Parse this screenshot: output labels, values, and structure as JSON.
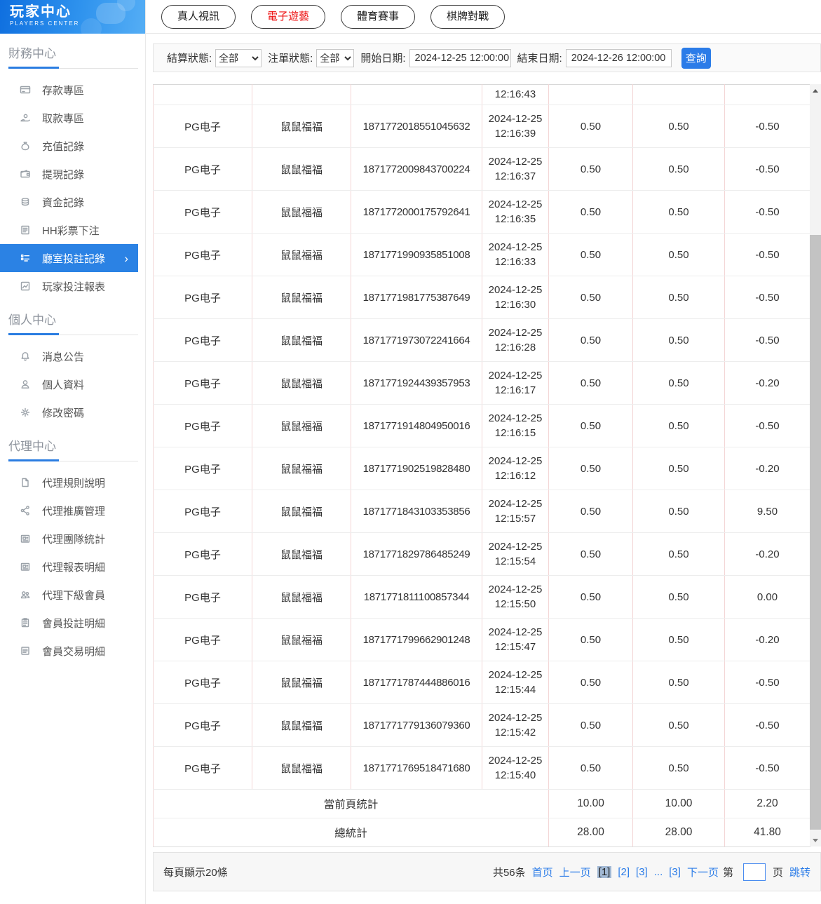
{
  "app": {
    "title": "玩家中心",
    "subtitle": "PLAYERS CENTER"
  },
  "sidebar": {
    "sections": [
      {
        "title": "財務中心",
        "items": [
          {
            "label": "存款專區",
            "icon": "deposit-card-icon",
            "active": false
          },
          {
            "label": "取款專區",
            "icon": "withdraw-hand-icon",
            "active": false
          },
          {
            "label": "充值記錄",
            "icon": "recharge-bag-icon",
            "active": false
          },
          {
            "label": "提現記錄",
            "icon": "cashout-wallet-icon",
            "active": false
          },
          {
            "label": "資金記錄",
            "icon": "funds-coins-icon",
            "active": false
          },
          {
            "label": "HH彩票下注",
            "icon": "lottery-doc-icon",
            "active": false
          },
          {
            "label": "廳室投註記錄",
            "icon": "bet-record-list-icon",
            "active": true
          },
          {
            "label": "玩家投注報表",
            "icon": "report-chart-icon",
            "active": false
          }
        ]
      },
      {
        "title": "個人中心",
        "items": [
          {
            "label": "消息公告",
            "icon": "bell-icon",
            "active": false
          },
          {
            "label": "個人資料",
            "icon": "person-icon",
            "active": false
          },
          {
            "label": "修改密碼",
            "icon": "gear-icon",
            "active": false
          }
        ]
      },
      {
        "title": "代理中心",
        "items": [
          {
            "label": "代理規則說明",
            "icon": "file-icon",
            "active": false
          },
          {
            "label": "代理推廣管理",
            "icon": "share-icon",
            "active": false
          },
          {
            "label": "代理團隊統計",
            "icon": "news-icon",
            "active": false
          },
          {
            "label": "代理報表明細",
            "icon": "news-icon",
            "active": false
          },
          {
            "label": "代理下級會員",
            "icon": "users-icon",
            "active": false
          },
          {
            "label": "會員投註明細",
            "icon": "clipboard-icon",
            "active": false
          },
          {
            "label": "會員交易明細",
            "icon": "list-icon",
            "active": false
          }
        ]
      }
    ]
  },
  "tabs": [
    {
      "label": "真人視訊",
      "active": false
    },
    {
      "label": "電子遊藝",
      "active": true
    },
    {
      "label": "體育賽事",
      "active": false
    },
    {
      "label": "棋牌對戰",
      "active": false
    }
  ],
  "filters": {
    "settle_status": {
      "label": "結算狀態:",
      "value": "全部"
    },
    "order_status": {
      "label": "注單狀態:",
      "value": "全部"
    },
    "start_date": {
      "label": "開始日期:",
      "value": "2024-12-25 12:00:00"
    },
    "end_date": {
      "label": "結束日期:",
      "value": "2024-12-26 12:00:00"
    },
    "search_label": "查詢"
  },
  "table": {
    "partial_row": {
      "time": "12:16:43"
    },
    "rows": [
      {
        "provider": "PG电子",
        "game": "鼠鼠福福",
        "order": "1871772018551045632",
        "date": "2024-12-25",
        "time": "12:16:39",
        "bet": "0.50",
        "valid": "0.50",
        "profit": "-0.50"
      },
      {
        "provider": "PG电子",
        "game": "鼠鼠福福",
        "order": "1871772009843700224",
        "date": "2024-12-25",
        "time": "12:16:37",
        "bet": "0.50",
        "valid": "0.50",
        "profit": "-0.50"
      },
      {
        "provider": "PG电子",
        "game": "鼠鼠福福",
        "order": "1871772000175792641",
        "date": "2024-12-25",
        "time": "12:16:35",
        "bet": "0.50",
        "valid": "0.50",
        "profit": "-0.50"
      },
      {
        "provider": "PG电子",
        "game": "鼠鼠福福",
        "order": "1871771990935851008",
        "date": "2024-12-25",
        "time": "12:16:33",
        "bet": "0.50",
        "valid": "0.50",
        "profit": "-0.50"
      },
      {
        "provider": "PG电子",
        "game": "鼠鼠福福",
        "order": "1871771981775387649",
        "date": "2024-12-25",
        "time": "12:16:30",
        "bet": "0.50",
        "valid": "0.50",
        "profit": "-0.50"
      },
      {
        "provider": "PG电子",
        "game": "鼠鼠福福",
        "order": "1871771973072241664",
        "date": "2024-12-25",
        "time": "12:16:28",
        "bet": "0.50",
        "valid": "0.50",
        "profit": "-0.50"
      },
      {
        "provider": "PG电子",
        "game": "鼠鼠福福",
        "order": "1871771924439357953",
        "date": "2024-12-25",
        "time": "12:16:17",
        "bet": "0.50",
        "valid": "0.50",
        "profit": "-0.20"
      },
      {
        "provider": "PG电子",
        "game": "鼠鼠福福",
        "order": "1871771914804950016",
        "date": "2024-12-25",
        "time": "12:16:15",
        "bet": "0.50",
        "valid": "0.50",
        "profit": "-0.50"
      },
      {
        "provider": "PG电子",
        "game": "鼠鼠福福",
        "order": "1871771902519828480",
        "date": "2024-12-25",
        "time": "12:16:12",
        "bet": "0.50",
        "valid": "0.50",
        "profit": "-0.20"
      },
      {
        "provider": "PG电子",
        "game": "鼠鼠福福",
        "order": "1871771843103353856",
        "date": "2024-12-25",
        "time": "12:15:57",
        "bet": "0.50",
        "valid": "0.50",
        "profit": "9.50"
      },
      {
        "provider": "PG电子",
        "game": "鼠鼠福福",
        "order": "1871771829786485249",
        "date": "2024-12-25",
        "time": "12:15:54",
        "bet": "0.50",
        "valid": "0.50",
        "profit": "-0.20"
      },
      {
        "provider": "PG电子",
        "game": "鼠鼠福福",
        "order": "1871771811100857344",
        "date": "2024-12-25",
        "time": "12:15:50",
        "bet": "0.50",
        "valid": "0.50",
        "profit": "0.00"
      },
      {
        "provider": "PG电子",
        "game": "鼠鼠福福",
        "order": "1871771799662901248",
        "date": "2024-12-25",
        "time": "12:15:47",
        "bet": "0.50",
        "valid": "0.50",
        "profit": "-0.20"
      },
      {
        "provider": "PG电子",
        "game": "鼠鼠福福",
        "order": "1871771787444886016",
        "date": "2024-12-25",
        "time": "12:15:44",
        "bet": "0.50",
        "valid": "0.50",
        "profit": "-0.50"
      },
      {
        "provider": "PG电子",
        "game": "鼠鼠福福",
        "order": "1871771779136079360",
        "date": "2024-12-25",
        "time": "12:15:42",
        "bet": "0.50",
        "valid": "0.50",
        "profit": "-0.50"
      },
      {
        "provider": "PG电子",
        "game": "鼠鼠福福",
        "order": "1871771769518471680",
        "date": "2024-12-25",
        "time": "12:15:40",
        "bet": "0.50",
        "valid": "0.50",
        "profit": "-0.50"
      }
    ],
    "summary": [
      {
        "label": "當前頁統計",
        "bet": "10.00",
        "valid": "10.00",
        "profit": "2.20"
      },
      {
        "label": "總統計",
        "bet": "28.00",
        "valid": "28.00",
        "profit": "41.80"
      }
    ]
  },
  "pagination": {
    "per_page": "每頁顯示20條",
    "total": "共56条",
    "first": "首页",
    "prev": "上一页",
    "pages": [
      {
        "label": "[1]",
        "active": true
      },
      {
        "label": "[2]",
        "active": false
      },
      {
        "label": "[3]",
        "active": false
      },
      {
        "label": "...",
        "active": false
      },
      {
        "label": "[3]",
        "active": false
      }
    ],
    "next": "下一页",
    "jump_prefix": "第",
    "jump_suffix": "页",
    "jump_label": "跳转",
    "jump_value": ""
  },
  "colors": {
    "accent_blue": "#2b7ce8",
    "sidebar_selected_blue": "#2b82e4",
    "active_tab_red": "#ee1111",
    "table_border_pink": "#f3d6d6",
    "active_page_bg": "#a2b9d4"
  }
}
